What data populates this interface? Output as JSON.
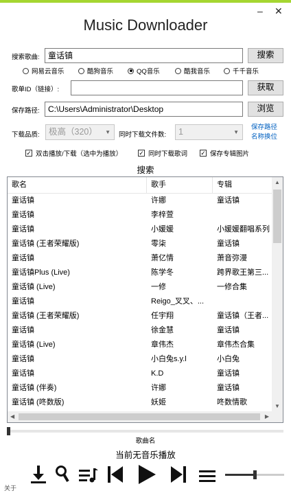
{
  "window": {
    "title": "Music Downloader",
    "minimize": "–",
    "close": "✕"
  },
  "search": {
    "label": "搜索歌曲:",
    "value": "童话镇",
    "button": "搜索"
  },
  "sources": [
    {
      "label": "网易云音乐",
      "selected": false
    },
    {
      "label": "酷狗音乐",
      "selected": false
    },
    {
      "label": "QQ音乐",
      "selected": true
    },
    {
      "label": "酷我音乐",
      "selected": false
    },
    {
      "label": "千千音乐",
      "selected": false
    }
  ],
  "playlist": {
    "label": "歌单ID（链接）:",
    "value": "",
    "button": "获取"
  },
  "save": {
    "label": "保存路径:",
    "value": "C:\\Users\\Administrator\\Desktop",
    "button": "浏览"
  },
  "quality": {
    "label": "下载品质:",
    "value": "极高（320）"
  },
  "concurrent": {
    "label": "同时下载文件数:",
    "value": "1"
  },
  "save_path_link": {
    "line1": "保存路径",
    "line2": "名称换位"
  },
  "options": [
    {
      "label": "双击播放/下载（选中为播放）",
      "checked": true
    },
    {
      "label": "同时下载歌词",
      "checked": true
    },
    {
      "label": "保存专辑图片",
      "checked": true
    }
  ],
  "results_title": "搜索",
  "table": {
    "columns": [
      "歌名",
      "歌手",
      "专辑"
    ],
    "rows": [
      [
        "童话镇",
        "许娜",
        "童话镇"
      ],
      [
        "童话镇",
        "李梓萱",
        ""
      ],
      [
        "童话镇",
        "小媛媛",
        "小媛媛翻唱系列"
      ],
      [
        "童话镇 (王者荣耀版)",
        "零柒",
        "童话镇"
      ],
      [
        "童话镇",
        "萧亿情",
        "萧音弥漫"
      ],
      [
        "童话镇Plus (Live)",
        "陈学冬",
        "跨界歌王第三..."
      ],
      [
        "童话镇 (Live)",
        "一修",
        "一修合集"
      ],
      [
        "童话镇",
        "Reigo_叉叉、...",
        ""
      ],
      [
        "童话镇 (王者荣耀版)",
        "任宇翔",
        "童话镇（王者..."
      ],
      [
        "童话镇",
        "徐金慧",
        "童话镇"
      ],
      [
        "童话镇 (Live)",
        "章伟杰",
        "章伟杰合集"
      ],
      [
        "童话镇",
        "小白兔s.y.l",
        "小白兔"
      ],
      [
        "童话镇",
        "K.D",
        "童话镇"
      ],
      [
        "童话镇 (伴奏)",
        "许娜",
        "童话镇"
      ],
      [
        "童话镇 (咚数版)",
        "妖姬",
        "咚数情歌"
      ]
    ]
  },
  "player": {
    "song_label": "歌曲名",
    "status": "当前无音乐播放",
    "progress": 0,
    "volume": 0.5,
    "about": "关于"
  },
  "icons": [
    "download-icon",
    "search-icon",
    "playlist-icon",
    "previous-icon",
    "play-icon",
    "next-icon",
    "menu-icon"
  ]
}
